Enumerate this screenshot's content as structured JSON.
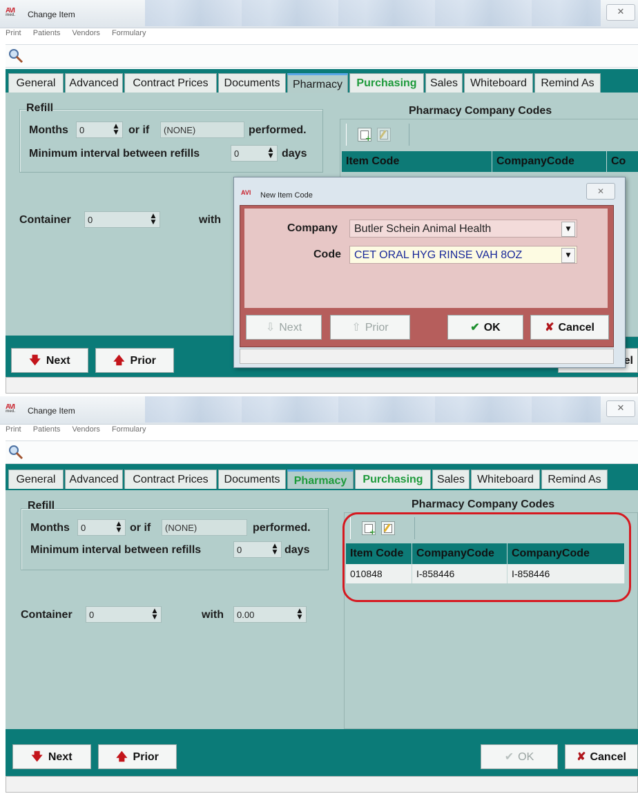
{
  "top": {
    "title": "Change Item",
    "menu": [
      "Print",
      "Patients",
      "Vendors",
      "Formulary"
    ],
    "tabs": [
      "General",
      "Advanced",
      "Contract Prices",
      "Documents",
      "Pharmacy",
      "Purchasing",
      "Sales",
      "Whiteboard",
      "Remind As"
    ],
    "refill": {
      "legend": "Refill",
      "months_label": "Months",
      "months_value": "0",
      "orif_label": "or if",
      "performed_value": "(NONE)",
      "performed_label": "performed.",
      "interval_label": "Minimum interval between refills",
      "interval_value": "0",
      "days_label": "days"
    },
    "container_label": "Container",
    "container_value": "0",
    "with_label": "with",
    "pcc_title": "Pharmacy Company Codes",
    "grid_headers": [
      "Item Code",
      "CompanyCode",
      "Co"
    ],
    "buttons": {
      "next": "Next",
      "prior": "Prior",
      "cancel_partial": "el"
    },
    "dialog": {
      "title": "New Item Code",
      "company_label": "Company",
      "company_value": "Butler Schein Animal Health",
      "code_label": "Code",
      "code_value": "CET ORAL HYG RINSE VAH 8OZ",
      "next": "Next",
      "prior": "Prior",
      "ok": "OK",
      "cancel": "Cancel"
    }
  },
  "bottom": {
    "title": "Change Item",
    "menu": [
      "Print",
      "Patients",
      "Vendors",
      "Formulary"
    ],
    "tabs": [
      "General",
      "Advanced",
      "Contract Prices",
      "Documents",
      "Pharmacy",
      "Purchasing",
      "Sales",
      "Whiteboard",
      "Remind As"
    ],
    "refill": {
      "legend": "Refill",
      "months_label": "Months",
      "months_value": "0",
      "orif_label": "or if",
      "performed_value": "(NONE)",
      "performed_label": "performed.",
      "interval_label": "Minimum interval between refills",
      "interval_value": "0",
      "days_label": "days"
    },
    "container_label": "Container",
    "container_value": "0",
    "with_label": "with",
    "with_value": "0.00",
    "pcc_title": "Pharmacy Company Codes",
    "grid_headers": [
      "Item Code",
      "CompanyCode",
      "CompanyCode"
    ],
    "grid_rows": [
      [
        "010848",
        "I-858446",
        "I-858446"
      ]
    ],
    "buttons": {
      "next": "Next",
      "prior": "Prior",
      "ok": "OK",
      "cancel": "Cancel"
    }
  },
  "colors": {
    "teal": "#0b7b78",
    "panel": "#b3cecb",
    "highlight_circle": "#d6181f",
    "green_tab": "#1d9a3a"
  }
}
